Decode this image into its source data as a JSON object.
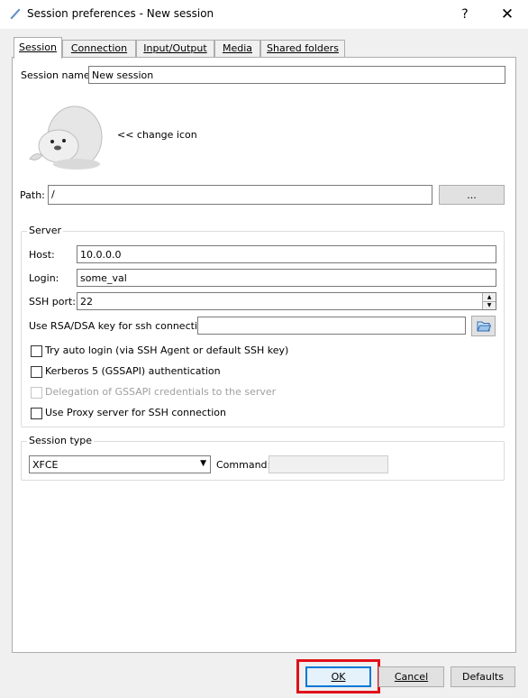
{
  "window": {
    "title": "Session preferences - New session",
    "help": "?",
    "close": "✕"
  },
  "tabs": [
    {
      "label": "Session",
      "active": true
    },
    {
      "label": "Connection"
    },
    {
      "label": "Input/Output"
    },
    {
      "label": "Media"
    },
    {
      "label": "Shared folders"
    }
  ],
  "session": {
    "name_label": "Session name:",
    "name_value": "New session",
    "change_icon_label": "<< change icon",
    "path_label": "Path:",
    "path_value": "/",
    "browse_label": "..."
  },
  "server": {
    "legend": "Server",
    "host_label": "Host:",
    "host_value": "10.0.0.0",
    "login_label": "Login:",
    "login_value": "some_val",
    "port_label": "SSH port:",
    "port_value": "22",
    "key_label": "Use RSA/DSA key for ssh connection:",
    "key_value": "",
    "options": {
      "auto_login": "Try auto login (via SSH Agent or default SSH key)",
      "kerberos": "Kerberos 5 (GSSAPI) authentication",
      "delegation": "Delegation of GSSAPI credentials to the server",
      "proxy": "Use Proxy server for SSH connection"
    }
  },
  "session_type": {
    "legend": "Session type",
    "selected": "XFCE",
    "command_label": "Command:",
    "command_value": ""
  },
  "buttons": {
    "ok": "OK",
    "cancel": "Cancel",
    "defaults": "Defaults"
  },
  "colors": {
    "accent": "#0078d7",
    "highlight": "#e0101a"
  }
}
